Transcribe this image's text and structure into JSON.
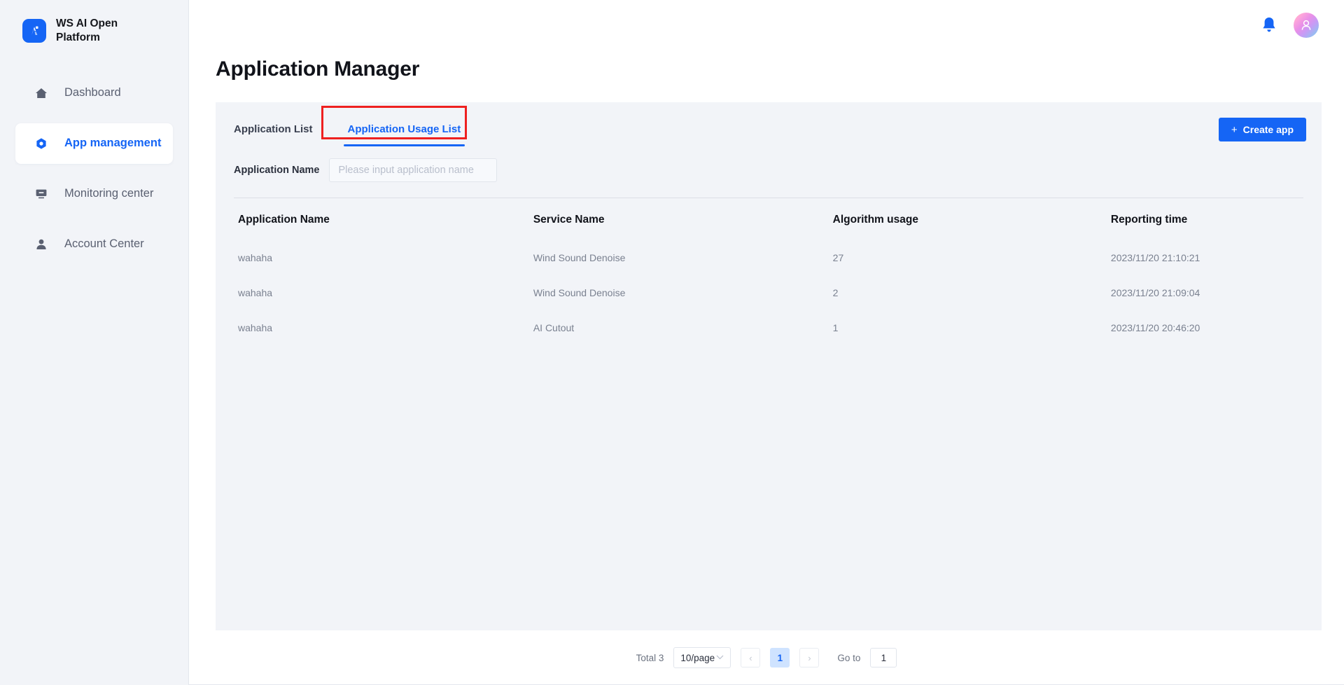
{
  "brand": {
    "name": "WS AI Open Platform",
    "logo_icon": "ws-logo-icon"
  },
  "sidebar": {
    "items": [
      {
        "label": "Dashboard",
        "icon": "home-icon",
        "active": false
      },
      {
        "label": "App management",
        "icon": "hexagon-icon",
        "active": true
      },
      {
        "label": "Monitoring center",
        "icon": "monitor-icon",
        "active": false
      },
      {
        "label": "Account Center",
        "icon": "user-icon",
        "active": false
      }
    ]
  },
  "topbar": {
    "bell_icon": "bell-icon",
    "avatar_icon": "avatar-user-icon"
  },
  "page": {
    "title": "Application Manager"
  },
  "tabs": [
    {
      "label": "Application List",
      "active": false
    },
    {
      "label": "Application Usage List",
      "active": true
    }
  ],
  "toolbar": {
    "create_label": "Create app",
    "create_plus": "+"
  },
  "filter": {
    "label": "Application Name",
    "value": "",
    "placeholder": "Please input application name"
  },
  "table": {
    "columns": [
      "Application Name",
      "Service Name",
      "Algorithm usage",
      "Reporting time"
    ],
    "rows": [
      {
        "app": "wahaha",
        "service": "Wind Sound Denoise",
        "usage": "27",
        "time": "2023/11/20 21:10:21"
      },
      {
        "app": "wahaha",
        "service": "Wind Sound Denoise",
        "usage": "2",
        "time": "2023/11/20 21:09:04"
      },
      {
        "app": "wahaha",
        "service": "AI Cutout",
        "usage": "1",
        "time": "2023/11/20 20:46:20"
      }
    ]
  },
  "pagination": {
    "total_label": "Total 3",
    "page_size": "10/page",
    "chevron": "⌄",
    "prev": "‹",
    "next": "›",
    "current_page": "1",
    "goto_label": "Go to",
    "goto_value": "1"
  },
  "colors": {
    "accent": "#1565f5",
    "highlight_box": "#ee2020",
    "sidebar_bg": "#f2f4f8",
    "card_bg": "#f2f4f8"
  }
}
